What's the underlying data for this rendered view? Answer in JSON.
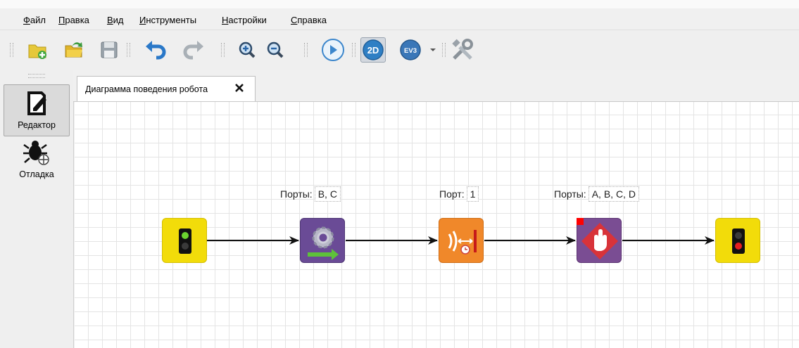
{
  "menu": [
    "Файл",
    "Правка",
    "Вид",
    "Инструменты",
    "Настройки",
    "Справка"
  ],
  "toolbar": {
    "icons": [
      "new-diagram-icon",
      "open-icon",
      "save-icon",
      "undo-icon",
      "redo-icon",
      "zoom-in-icon",
      "zoom-out-icon",
      "run-icon",
      "2d-model-icon",
      "ev3-icon",
      "dropdown-arrow-icon",
      "robot-settings-icon"
    ],
    "mode_2d": "2D",
    "mode_ev3": "EV3"
  },
  "dock": {
    "editor_label": "Редактор",
    "debug_label": "Отладка"
  },
  "tab": {
    "title": "Диаграмма поведения робота"
  },
  "blocks": {
    "motors": {
      "prop_label": "Порты:",
      "prop_value": "B, C"
    },
    "timer": {
      "prop_label": "Порт:",
      "prop_value": "1"
    },
    "stop": {
      "prop_label": "Порты:",
      "prop_value": "A, B, C, D"
    }
  },
  "colors": {
    "start_end": "#f2dc0a",
    "motors": "#6a4b96",
    "timer": "#f0882a",
    "stop": "#7a4d93",
    "selection_marker": "#ff0000"
  }
}
